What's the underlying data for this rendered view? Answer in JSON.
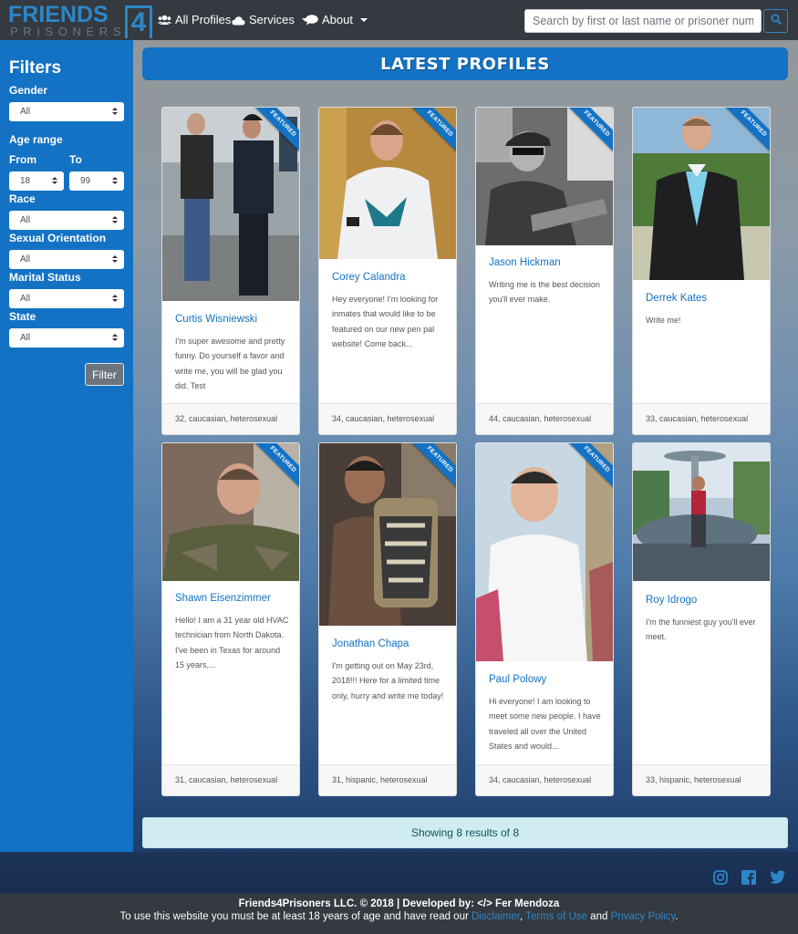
{
  "navbar": {
    "logo_top": "FRIENDS",
    "logo_four": "4",
    "logo_bottom": "PRISONERS",
    "all_profiles": "All Profiles",
    "services": "Services",
    "about": "About",
    "search_placeholder": "Search by first or last name or prisoner number"
  },
  "sidebar": {
    "title": "Filters",
    "gender_label": "Gender",
    "gender_value": "All",
    "age_label": "Age range",
    "from_label": "From",
    "to_label": "To",
    "from_value": "18",
    "to_value": "99",
    "race_label": "Race",
    "race_value": "All",
    "orientation_label": "Sexual Orientation",
    "orientation_value": "All",
    "marital_label": "Marital Status",
    "marital_value": "All",
    "state_label": "State",
    "state_value": "All",
    "filter_button": "Filter"
  },
  "main": {
    "title": "Latest profiles",
    "featured_label": "FEATURED",
    "profiles": [
      {
        "name": "Curtis Wisniewski",
        "desc": "I'm super awesome and pretty funny. Do yourself a favor and write me, you will be glad you did. Test",
        "meta": "32, caucasian, heterosexual",
        "featured": true
      },
      {
        "name": "Corey Calandra",
        "desc": "Hey everyone! I'm looking for inmates that would like to be featured on our new pen pal website! Come back...",
        "meta": "34, caucasian, heterosexual",
        "featured": true
      },
      {
        "name": "Jason Hickman",
        "desc": "Writing me is the best decision you'll ever make.",
        "meta": "44, caucasian, heterosexual",
        "featured": true
      },
      {
        "name": "Derrek Kates",
        "desc": "Write me!",
        "meta": "33, caucasian, heterosexual",
        "featured": true
      },
      {
        "name": "Shawn Eisenzimmer",
        "desc": "Hello! I am a 31 year old HVAC technician from North Dakota. I've been in Texas for around 15 years,...",
        "meta": "31, caucasian, heterosexual",
        "featured": true
      },
      {
        "name": "Jonathan Chapa",
        "desc": "I'm getting out on May 23rd, 2018!!! Here for a limited time only, hurry and write me today!",
        "meta": "31, hispanic, heterosexual",
        "featured": true
      },
      {
        "name": "Paul Polowy",
        "desc": "Hi everyone! I am looking to meet some new people. I have traveled all over the United States and would...",
        "meta": "34, caucasian, heterosexual",
        "featured": true
      },
      {
        "name": "Roy Idrogo",
        "desc": "I'm the funniest guy you'll ever meet.",
        "meta": "33, hispanic, heterosexual",
        "featured": false
      }
    ],
    "results_text": "Showing 8 results of 8"
  },
  "footer": {
    "line1": "Friends4Prisoners LLC. © 2018 | Developed by: </> Fer Mendoza",
    "line2_pre": "To use this website you must be at least 18 years of age and have read our ",
    "disclaimer": "Disclaimer",
    "sep": ", ",
    "terms": "Terms of Use",
    "and": " and ",
    "privacy": "Privacy Policy",
    "end": "."
  },
  "colors": {
    "brand_blue": "#1372c4",
    "navbar": "#343a40",
    "link_blue": "#2d86c8",
    "results_bg": "#d1ecf1"
  }
}
